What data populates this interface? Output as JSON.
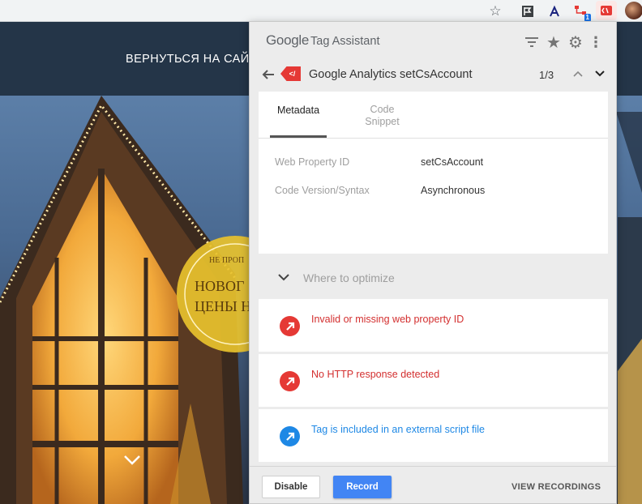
{
  "browser": {
    "star_icon": "star-outline-icon",
    "extensions": [
      "flag-extension-icon",
      "network-extension-icon",
      "sitemap-extension-icon",
      "tag-assistant-extension-icon"
    ],
    "extension_badge": "1"
  },
  "website": {
    "back_link": "ВЕРНУТЬСЯ НА САЙ",
    "promo_line1": "НЕ ПРОП",
    "promo_line2": "НОВОГ",
    "promo_line3": "ЦЕНЫ Н"
  },
  "tag_assistant": {
    "logo_google": "Google",
    "logo_product": "Tag Assistant",
    "tag": {
      "badge": "</",
      "name": "Google Analytics setCsAccount",
      "position": "1/3"
    },
    "tabs": [
      {
        "label": "Metadata",
        "active": true
      },
      {
        "label": "Code Snippet",
        "active": false
      }
    ],
    "metadata": [
      {
        "key": "Web Property ID",
        "value": "setCsAccount"
      },
      {
        "key": "Code Version/Syntax",
        "value": "Asynchronous"
      }
    ],
    "optimize_title": "Where to optimize",
    "issues": [
      {
        "text": "Invalid or missing web property ID",
        "severity": "red"
      },
      {
        "text": "No HTTP response detected",
        "severity": "red"
      },
      {
        "text": "Tag is included in an external script file",
        "severity": "blue"
      }
    ],
    "footer": {
      "disable_label": "Disable",
      "record_label": "Record",
      "view_recordings_label": "VIEW RECORDINGS"
    }
  },
  "colors": {
    "record_button": "#4285f4",
    "issue_red": "#d32f2f",
    "issue_blue": "#1e88e5",
    "tag_badge": "#e53935"
  }
}
